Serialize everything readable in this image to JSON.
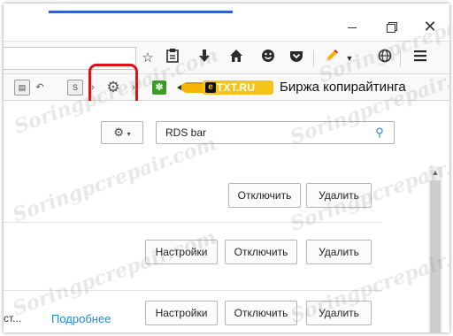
{
  "window": {
    "minimize_icon": "minimize-icon",
    "restore_icon": "restore-icon",
    "close_glyph": "✕"
  },
  "toolbar": {
    "icons": [
      "star-icon",
      "reading-list-icon",
      "download-icon",
      "home-icon",
      "smiley-icon",
      "pocket-icon",
      "pencil-icon",
      "chevron-down-icon",
      "globe-icon",
      "menu-icon"
    ]
  },
  "addon_bar": {
    "etxt_e": "e",
    "etxt_label": "TXT.RU",
    "birja_label": "Биржа копирайтинга"
  },
  "addons_page": {
    "search": {
      "value": "RDS bar"
    },
    "rows": [
      {
        "disable_label": "Отключить",
        "remove_label": "Удалить"
      },
      {
        "settings_label": "Настройки",
        "disable_label": "Отключить",
        "remove_label": "Удалить"
      },
      {
        "desc_tail": "ст...",
        "more_label": "Подробнее",
        "settings_label": "Настройки",
        "disable_label": "Отключить",
        "remove_label": "Удалить"
      }
    ]
  },
  "watermark": "Soringpcrepair.com",
  "colors": {
    "highlight": "#e10f0f",
    "link": "#1d8ad0",
    "etxt_yellow": "#f7c31a",
    "tab_accent": "#2a65c4"
  }
}
